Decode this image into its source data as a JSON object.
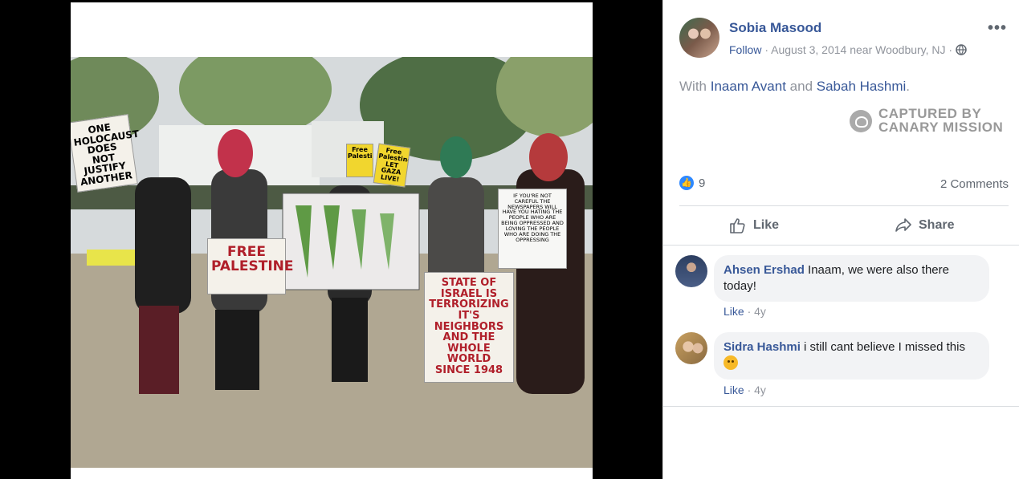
{
  "post": {
    "author": "Sobia Masood",
    "follow_label": "Follow",
    "meta": " · August 3, 2014 near Woodbury, NJ · ",
    "more_label": "•••",
    "caption_with": "With ",
    "tag1": "Inaam Avant",
    "caption_and": " and ",
    "tag2": "Sabah Hashmi",
    "caption_end": "."
  },
  "watermark": {
    "line1": "CAPTURED BY",
    "line2": "CANARY MISSION"
  },
  "stats": {
    "likes": "9",
    "comments": "2 Comments"
  },
  "actions": {
    "like": "Like",
    "share": "Share"
  },
  "photo_signs": {
    "sign1": "ONE HOLOCAUST DOES NOT JUSTIFY ANOTHER",
    "sign2": "FREE PALESTINE",
    "sign3": "STATE OF ISRAEL IS TERRORIZING IT'S NEIGHBORS AND THE WHOLE WORLD SINCE 1948",
    "sign4": "Free Palestine",
    "sign5": "Free Palestine LET GAZA LIVE!",
    "sign6": "IF YOU'RE NOT CAREFUL THE NEWSPAPERS WILL HAVE YOU HATING THE PEOPLE WHO ARE BEING OPPRESSED AND LOVING THE PEOPLE WHO ARE DOING THE OPPRESSING"
  },
  "comments": [
    {
      "author": "Ahsen Ershad",
      "text": " Inaam, we were also there today!",
      "like": "Like",
      "age": " · 4y"
    },
    {
      "author": "Sidra Hashmi",
      "text": " i still cant believe I missed this ",
      "like": "Like",
      "age": " · 4y"
    }
  ],
  "colors": {
    "link": "#385898",
    "muted": "#90949c",
    "like_blue": "#2d88ff"
  },
  "icons": [
    "more-options-icon",
    "globe-icon",
    "like-badge-icon",
    "thumbs-up-icon",
    "share-arrow-icon",
    "canary-mission-logo-icon",
    "frown-emoji-icon"
  ]
}
